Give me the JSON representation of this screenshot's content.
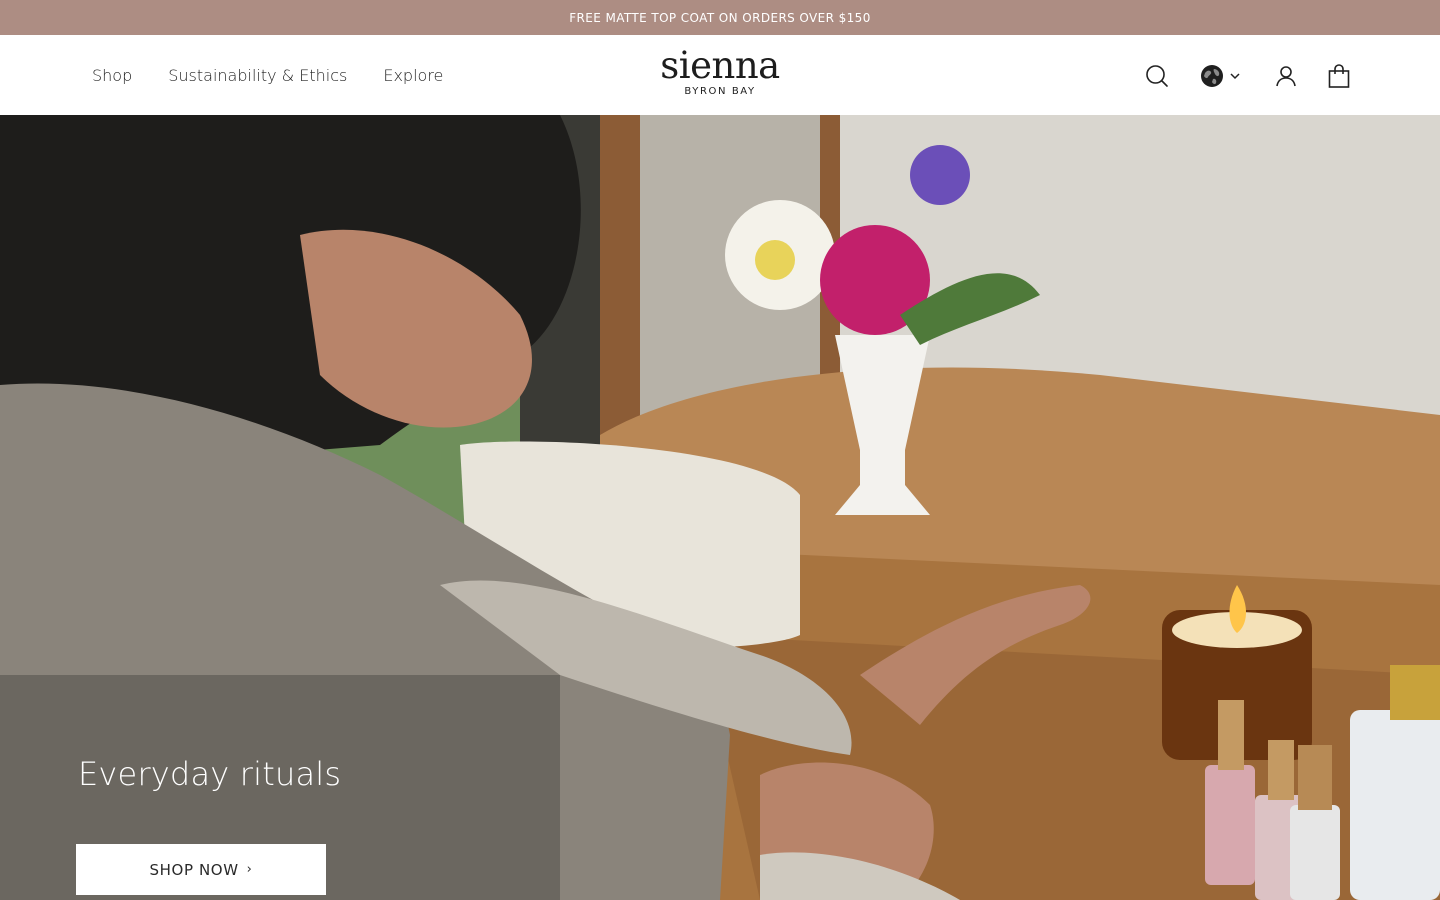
{
  "announcement": {
    "text": "FREE MATTE TOP COAT ON ORDERS OVER $150"
  },
  "nav": {
    "items": [
      {
        "label": "Shop"
      },
      {
        "label": "Sustainability & Ethics"
      },
      {
        "label": "Explore"
      }
    ]
  },
  "logo": {
    "main": "sienna",
    "sub": "BYRON BAY"
  },
  "header_icons": [
    "search-icon",
    "globe-icon",
    "chevron-down-icon",
    "account-icon",
    "cart-icon"
  ],
  "hero": {
    "title": "Everyday rituals",
    "cta_label": "SHOP NOW",
    "cta_chevron": "›"
  },
  "colors": {
    "announcement_bg": "#ad8d83",
    "text": "#222222",
    "button_bg": "#ffffff"
  }
}
